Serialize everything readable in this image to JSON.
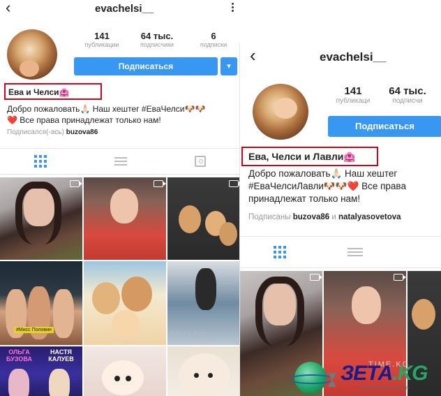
{
  "left": {
    "header": {
      "username": "evachelsi__"
    },
    "stats": [
      {
        "value": "141",
        "label": "публикации"
      },
      {
        "value": "64 тыс.",
        "label": "подписчики"
      },
      {
        "value": "6",
        "label": "подписки"
      }
    ],
    "subscribe_label": "Подписаться",
    "dropdown_icon": "▾",
    "profile_name": "Ева и Челси🏩",
    "bio_lines": [
      "Добро пожаловать🙏🏻 Наш хештег #ЕваЧелси🐶🐶",
      "❤️ Все права принадлежат только нам!"
    ],
    "followed_by_prefix": "Подписался(-ась)",
    "followed_by_user": "buzova86",
    "photo_posters": {
      "p7_line1": "ОЛЬГА",
      "p7_line2": "БУЗОВА",
      "p7_line3": "НАСТЯ",
      "p7_line4": "КАЛУЕВ",
      "p4_hashtag": "#Мисс Половин",
      "p6_wm": "ОЛЬГА БУЗ"
    }
  },
  "right": {
    "header": {
      "username": "evachelsi__"
    },
    "stats": [
      {
        "value": "141",
        "label": "публикаци"
      },
      {
        "value": "64 тыс.",
        "label": "подписчи"
      }
    ],
    "subscribe_label": "Подписаться",
    "profile_name": "Ева, Челси и Лавли🏩",
    "bio_lines": [
      "Добро пожаловать🙏🏻 Наш хештег",
      "#ЕваЧелсиЛавли🐶🐶❤️ Все права",
      "принадлежат только нам!"
    ],
    "followed_by_prefix": "Подписаны",
    "followed_by_user1": "buzova86",
    "followed_by_and": "и",
    "followed_by_user2": "natalyasovetova"
  },
  "watermark": {
    "brand": "ЗЕТА",
    "brand_suffix": ".KG",
    "tagline_top": "TIME.KG",
    "tagline_bottom": "вчера сегодня завтра"
  }
}
